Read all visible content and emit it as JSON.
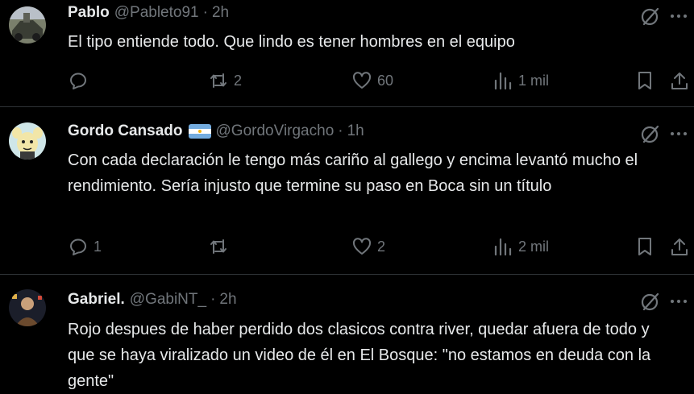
{
  "tweets": [
    {
      "name": "Pablo",
      "handle": "@Pableto91",
      "time": "2h",
      "verified_flag": false,
      "text": "El tipo entiende todo. Que lindo es tener hombres en el equipo",
      "replies": "",
      "reposts": "2",
      "likes": "60",
      "views": "1 mil"
    },
    {
      "name": "Gordo Cansado",
      "handle": "@GordoVirgacho",
      "time": "1h",
      "verified_flag": true,
      "text": "Con cada declaración le tengo más cariño al gallego y encima levantó mucho el rendimiento. Sería injusto que termine su paso en Boca sin un título",
      "replies": "1",
      "reposts": "",
      "likes": "2",
      "views": "2 mil"
    },
    {
      "name": "Gabriel.",
      "handle": "@GabiNT_",
      "time": "2h",
      "verified_flag": false,
      "text": "Rojo despues de haber perdido dos clasicos contra river, quedar afuera de todo y que se haya viralizado un video de él en El Bosque: \"no estamos en deuda con la gente\"",
      "replies": "",
      "reposts": "",
      "likes": "",
      "views": ""
    }
  ],
  "separator": "·",
  "icons": {
    "grok": "grok-icon",
    "more": "more-icon",
    "reply": "reply-icon",
    "repost": "repost-icon",
    "like": "like-icon",
    "views": "views-icon",
    "bookmark": "bookmark-icon",
    "share": "share-icon"
  },
  "colors": {
    "background": "#000000",
    "text": "#e7e9ea",
    "secondary": "#71767b",
    "border": "#2f3336"
  }
}
